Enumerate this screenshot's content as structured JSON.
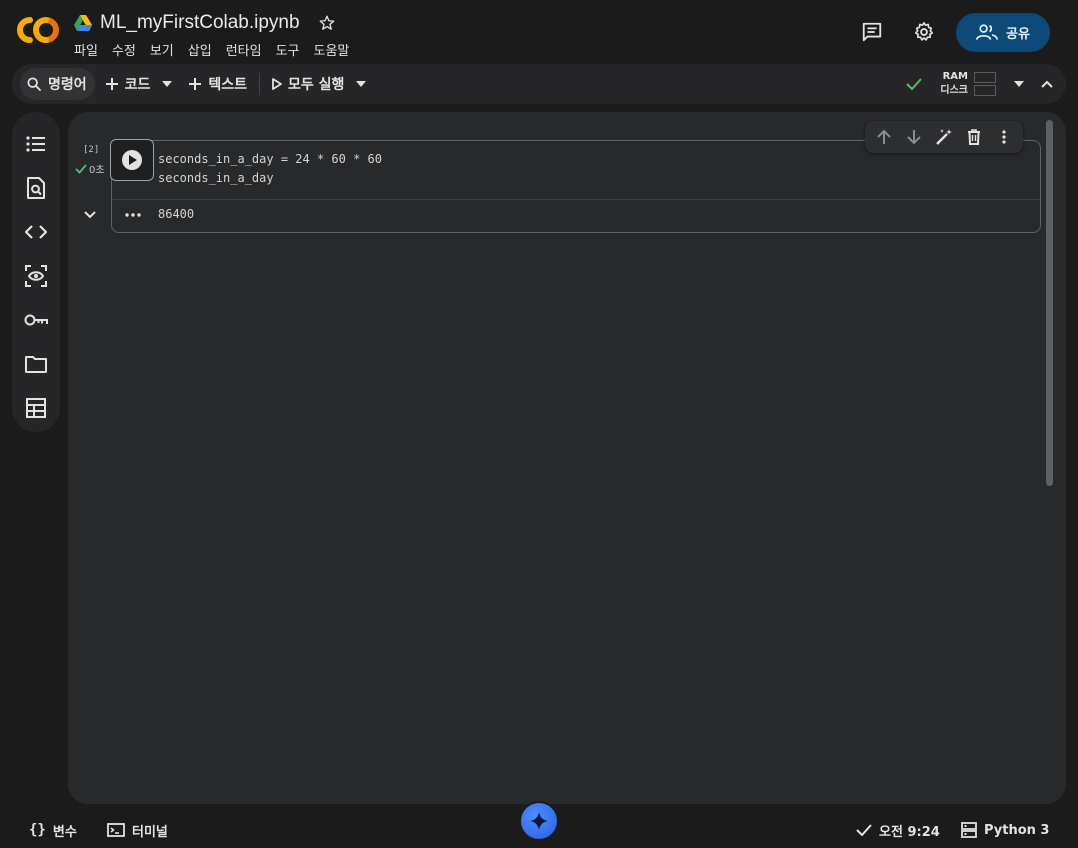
{
  "header": {
    "file_title": "ML_myFirstColab.ipynb",
    "menu": [
      "파일",
      "수정",
      "보기",
      "삽입",
      "런타임",
      "도구",
      "도움말"
    ],
    "share_label": "공유",
    "icons": [
      "comment-icon",
      "gear-icon"
    ]
  },
  "toolbar": {
    "command_label": "명령어",
    "add_code_label": "코드",
    "add_text_label": "텍스트",
    "run_all_label": "모두 실행",
    "ram_label": "RAM",
    "disk_label": "디스크"
  },
  "sidebar": {
    "icons": [
      "toc-icon",
      "find-icon",
      "code-snippets-icon",
      "variables-inspector-icon",
      "secrets-key-icon",
      "folder-icon",
      "table-icon"
    ]
  },
  "cell": {
    "exec_count": "[2]",
    "exec_time": "0초",
    "code_lines": [
      "seconds_in_a_day = 24 * 60 * 60",
      "seconds_in_a_day"
    ],
    "output": "86400"
  },
  "statusbar": {
    "variables_label": "변수",
    "terminal_label": "터미널",
    "time_label": "오전 9:24",
    "runtime_label": "Python 3"
  },
  "colors": {
    "accent": "#0d4a7a",
    "logo_orange": "#f9ab00",
    "logo_dark_orange": "#e8710a",
    "success_green": "#5bb974"
  }
}
